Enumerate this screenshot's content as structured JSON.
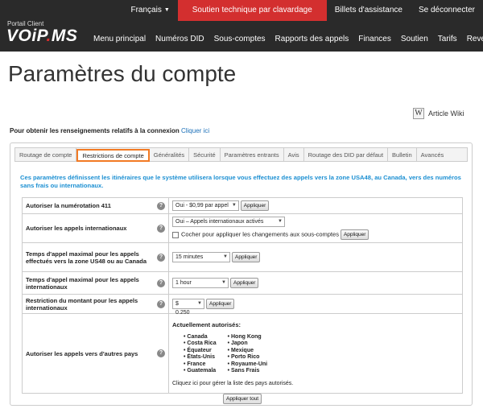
{
  "logo": {
    "subtitle": "Portail Client",
    "name_left": "VOiP",
    "name_dot": ".",
    "name_right": "MS"
  },
  "utilbar": {
    "language": "Français",
    "support": "Soutien technique par clavardage",
    "tickets": "Billets d'assistance",
    "logout": "Se déconnecter"
  },
  "nav": [
    "Menu principal",
    "Numéros DID",
    "Sous-comptes",
    "Rapports des appels",
    "Finances",
    "Soutien",
    "Tarifs",
    "Revendeur"
  ],
  "page": {
    "title": "Paramètres du compte"
  },
  "wiki": {
    "label": "Article Wiki",
    "icon_letter": "W"
  },
  "login_info": {
    "text": "Pour obtenir les renseignements relatifs à la connexion",
    "link": "Cliquer ici"
  },
  "tabs": [
    "Routage de compte",
    "Restrictions de compte",
    "Généralités",
    "Sécurité",
    "Paramètres entrants",
    "Avis",
    "Routage des DID par défaut",
    "Bulletin",
    "Avancés"
  ],
  "active_tab": "Restrictions de compte",
  "description": "Ces paramètres définissent les itinéraires que le système utilisera lorsque vous effectuez des appels vers la zone USA48, au Canada, vers des numéros sans frais ou internationaux.",
  "rows": {
    "r411": {
      "label": "Autoriser la numérotation 411",
      "value": "Oui - $0,99 par appel",
      "button": "Appliquer"
    },
    "intl": {
      "label": "Autoriser les appels internationaux",
      "value": "Oui – Appels internationaux activés",
      "checkbox": "Cocher pour appliquer les changements aux sous-comptes",
      "button": "Appliquer"
    },
    "maxusa": {
      "label": "Temps d'appel maximal pour les appels effectués vers la zone US48 ou au Canada",
      "value": "15 minutes",
      "button": "Appliquer"
    },
    "maxintl": {
      "label": "Temps d'appel maximal pour les appels internationaux",
      "value": "1 hour",
      "button": "Appliquer"
    },
    "amount": {
      "label": "Restriction du montant pour les appels internationaux",
      "value": "$ 0.250",
      "button": "Appliquer"
    },
    "countries": {
      "label": "Autoriser les appels vers d'autres pays",
      "title": "Actuellement autorisés:",
      "col1": [
        "Canada",
        "Costa Rica",
        "Équateur",
        "États-Unis",
        "France",
        "Guatemala"
      ],
      "col2": [
        "Hong Kong",
        "Japon",
        "Mexique",
        "Porto Rico",
        "Royaume-Uni",
        "Sans Frais"
      ],
      "manage": "Cliquez ici pour gérer la liste des pays autorisés."
    }
  },
  "apply_all": "Appliquer tout",
  "help_glyph": "?"
}
